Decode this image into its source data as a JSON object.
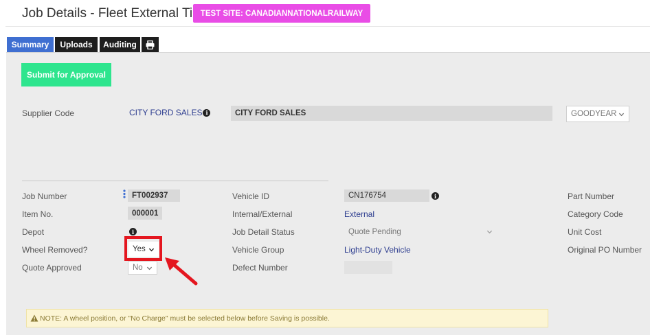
{
  "header": {
    "title": "Job Details - Fleet External Tires",
    "test_site_badge": "TEST SITE: CANADIANNATIONALRAILWAY"
  },
  "tabs": [
    {
      "label": "Summary",
      "active": true
    },
    {
      "label": "Uploads",
      "active": false
    },
    {
      "label": "Auditing",
      "active": false
    },
    {
      "label": "",
      "icon": "print-icon",
      "active": false
    }
  ],
  "actions": {
    "submit_label": "Submit for Approval"
  },
  "supplier": {
    "label": "Supplier Code",
    "code_link": "CITY FORD SALES",
    "name": "CITY FORD SALES",
    "brand_selected": "GOODYEAR"
  },
  "fields": {
    "job_number": {
      "label": "Job Number",
      "value": "FT002937"
    },
    "item_no": {
      "label": "Item No.",
      "value": "000001"
    },
    "depot": {
      "label": "Depot"
    },
    "wheel_removed": {
      "label": "Wheel Removed?",
      "value": "Yes"
    },
    "quote_approved": {
      "label": "Quote Approved",
      "value": "No"
    },
    "vehicle_id": {
      "label": "Vehicle ID",
      "value": "CN176754"
    },
    "internal_external": {
      "label": "Internal/External",
      "value": "External"
    },
    "job_detail_status": {
      "label": "Job Detail Status",
      "value": "Quote Pending"
    },
    "vehicle_group": {
      "label": "Vehicle Group",
      "value": "Light-Duty Vehicle"
    },
    "defect_number": {
      "label": "Defect Number",
      "value": ""
    },
    "part_number": {
      "label": "Part Number"
    },
    "category_code": {
      "label": "Category Code"
    },
    "unit_cost": {
      "label": "Unit Cost"
    },
    "original_po_number": {
      "label": "Original PO Number"
    }
  },
  "notice": {
    "text": "NOTE: A wheel position, or \"No Charge\" must be selected below before Saving is possible."
  },
  "colors": {
    "active_tab": "#3f6fd1",
    "submit_button": "#2ee58e",
    "test_badge": "#e94de6",
    "highlight": "#e4161f",
    "link": "#2d3d8f"
  }
}
